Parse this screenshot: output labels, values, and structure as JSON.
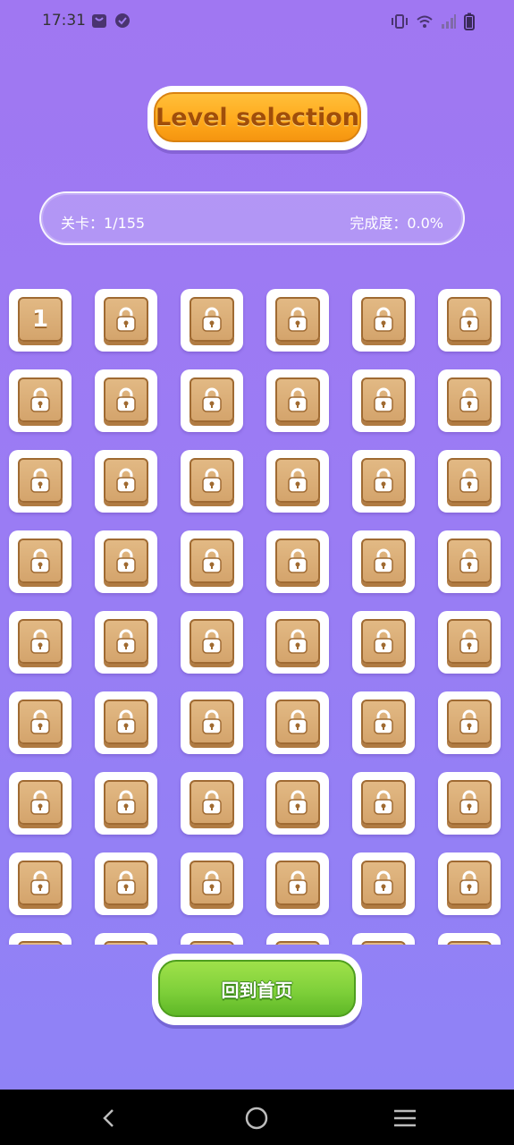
{
  "status_bar": {
    "time": "17:31",
    "left_icons": [
      "bag-icon",
      "check-badge-icon"
    ],
    "right_icons": [
      "vibrate-icon",
      "wifi-icon",
      "signal-icon",
      "battery-icon"
    ]
  },
  "header": {
    "title": "Level selection"
  },
  "progress": {
    "level_text": "关卡：1/155",
    "completion_text": "完成度：0.0%"
  },
  "levels": {
    "total": 155,
    "unlocked_label": "1",
    "locked_icon": "lock-icon"
  },
  "footer": {
    "home_button": "回到首页"
  },
  "nav": {
    "back_icon": "back-icon",
    "home_icon": "home-circle-icon",
    "menu_icon": "menu-icon"
  },
  "colors": {
    "background": "#9a7cf4",
    "title_orange": "#ffa81a",
    "tile_wood": "#d4a46c",
    "button_green": "#7fd03a"
  }
}
